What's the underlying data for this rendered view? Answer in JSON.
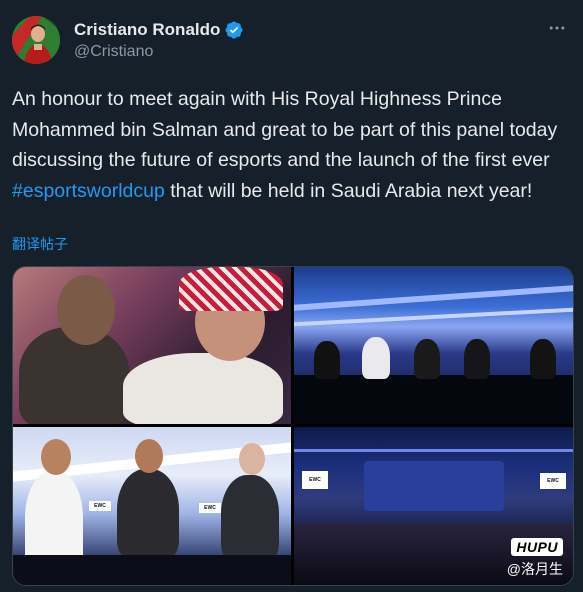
{
  "author": {
    "name": "Cristiano Ronaldo",
    "handle": "@Cristiano",
    "verified": true,
    "avatar_icon": "avatar-photo"
  },
  "tweet": {
    "text_before": "An honour to meet again with His Royal Highness Prince Mohammed bin Salman and great to be part of this panel today discussing the future of esports and the launch of the first ever ",
    "hashtag": "#esportsworldcup",
    "text_after": " that will be held in Saudi Arabia next year!",
    "translate_label": "翻译帖子"
  },
  "media": {
    "tile_count": 4
  },
  "watermark": {
    "brand": "HUPU",
    "user": "@洛月生"
  },
  "colors": {
    "background": "#15202b",
    "text": "#e7e9ea",
    "secondary": "#8b98a5",
    "accent": "#1d9bf0"
  },
  "icons": {
    "verified": "verified-badge-icon",
    "more": "more-options-icon"
  }
}
